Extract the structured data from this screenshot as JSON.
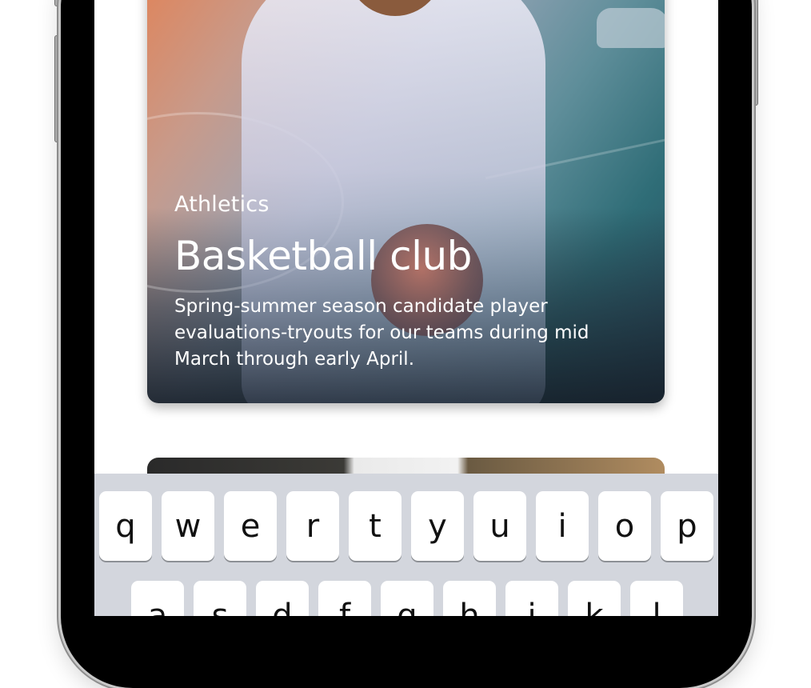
{
  "card": {
    "category": "Athletics",
    "title": "Basketball club",
    "description": "Spring-summer season candidate player evaluations-tryouts for our teams during mid March through early April."
  },
  "keyboard": {
    "row1": [
      "q",
      "w",
      "e",
      "r",
      "t",
      "y",
      "u",
      "i",
      "o",
      "p"
    ],
    "row2": [
      "a",
      "s",
      "d",
      "f",
      "g",
      "h",
      "j",
      "k",
      "l"
    ]
  }
}
